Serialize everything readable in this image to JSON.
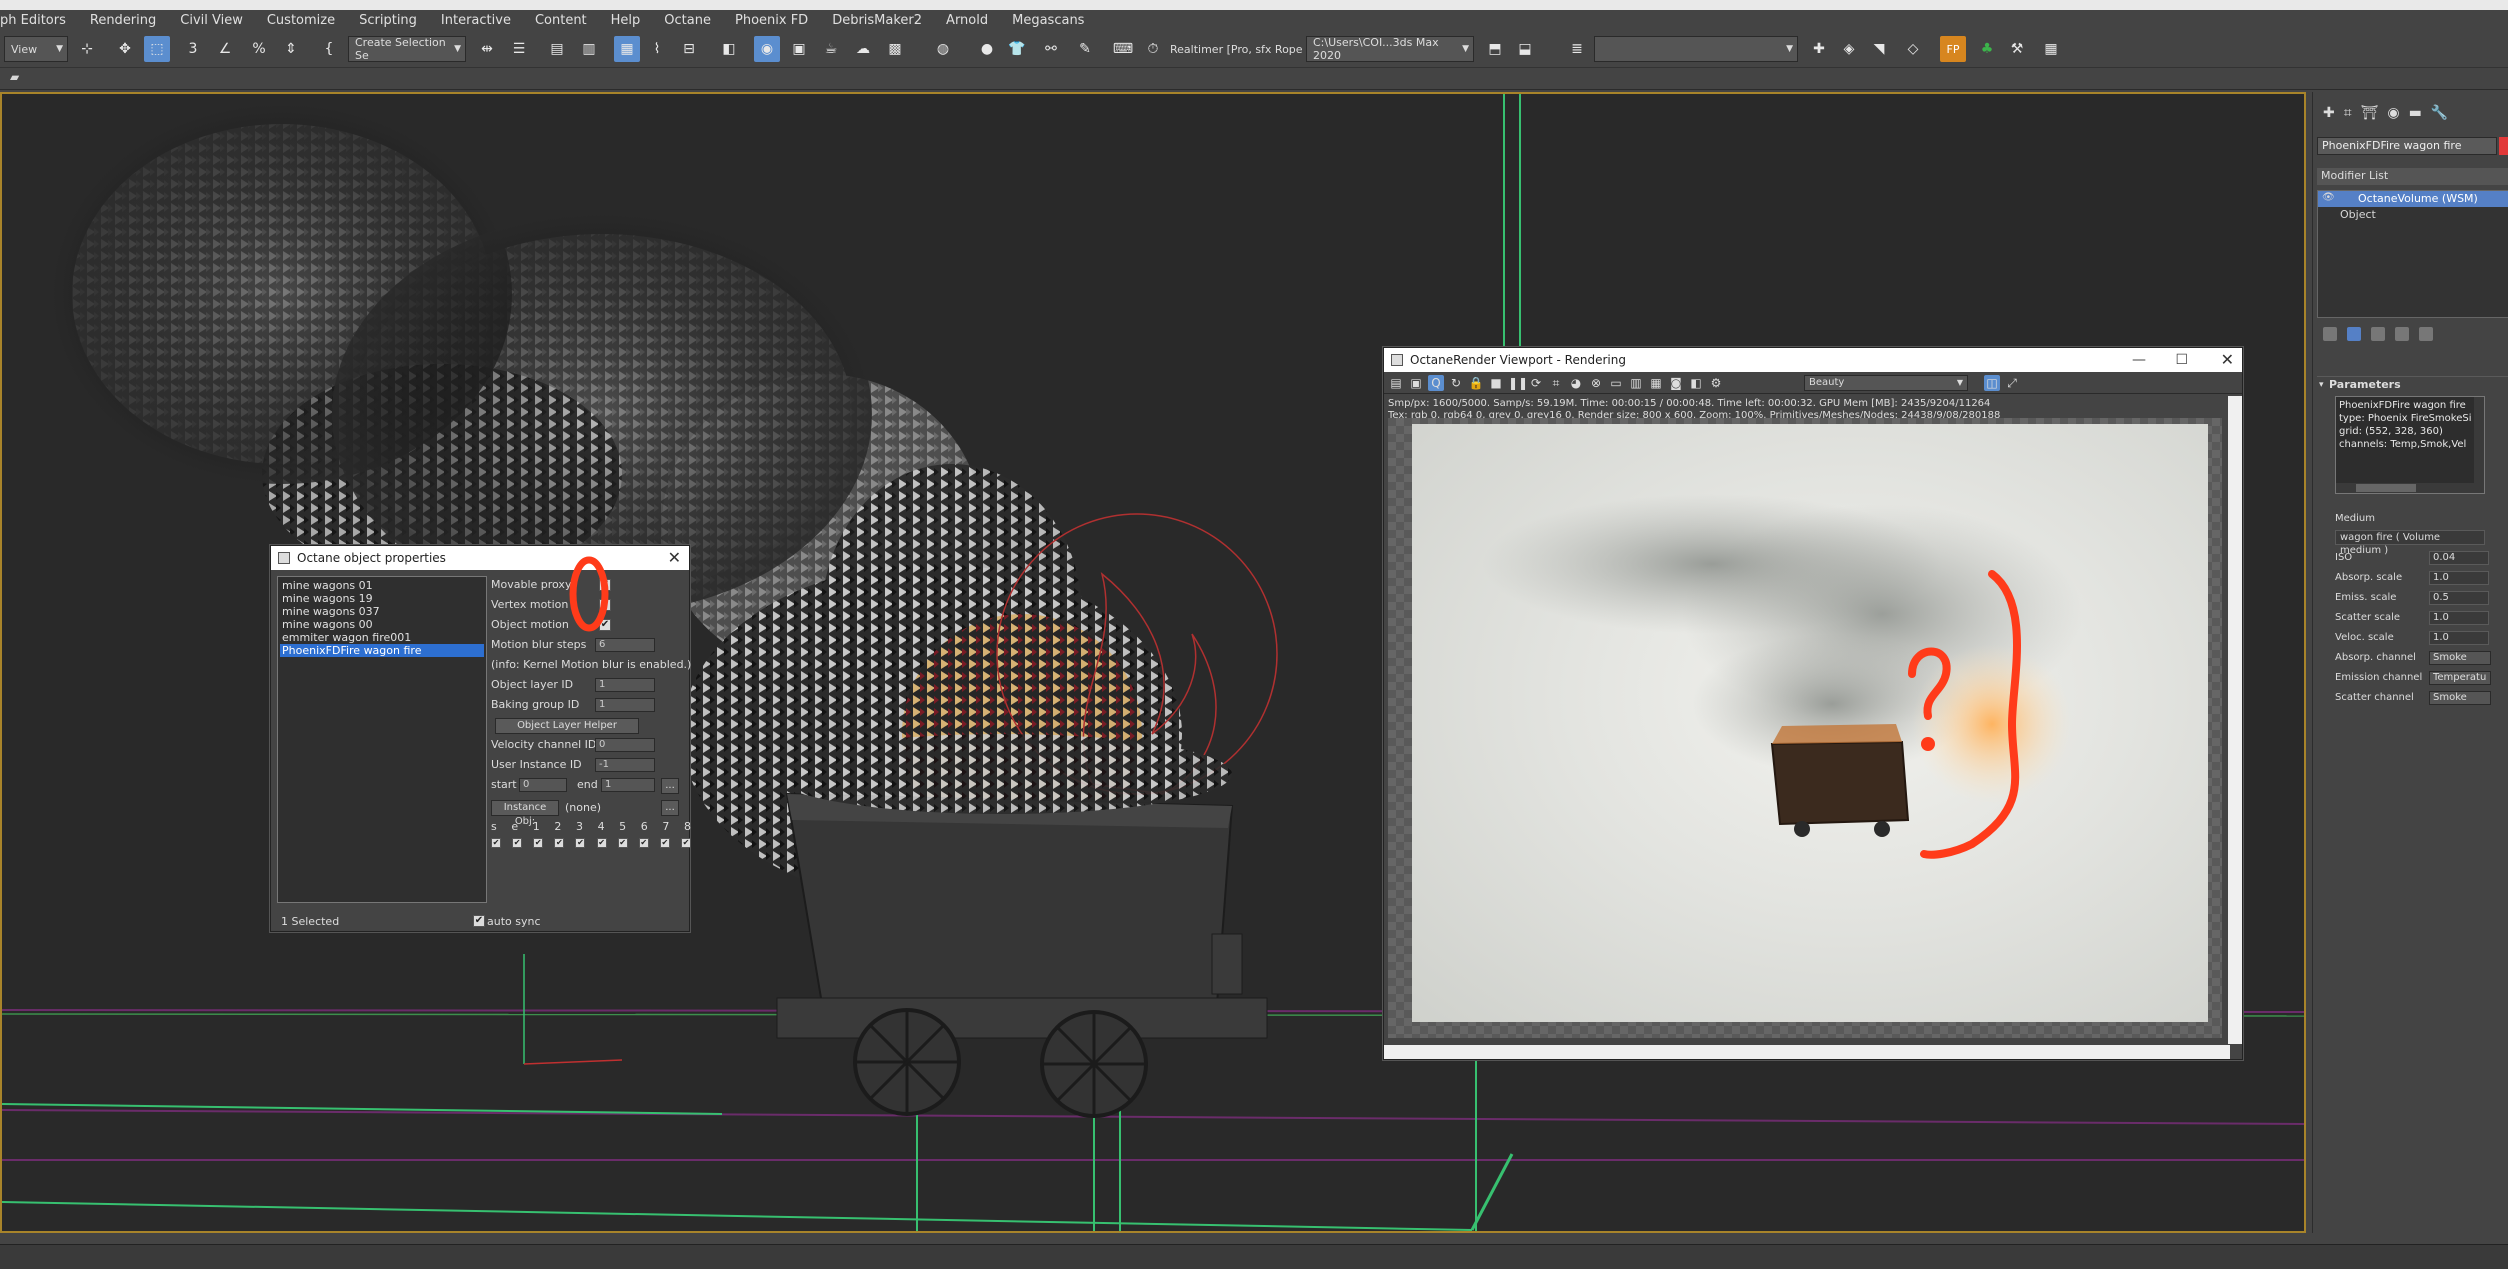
{
  "menu": [
    "ph Editors",
    "Rendering",
    "Civil View",
    "Customize",
    "Scripting",
    "Interactive",
    "Content",
    "Help",
    "Octane",
    "Phoenix FD",
    "DebrisMaker2",
    "Arnold",
    "Megascans"
  ],
  "toolbar": {
    "view_dropdown": "View",
    "selection_set": "Create Selection Se",
    "project_label": "Realtimer [Pro, sfx Rope C",
    "path_dropdown": "C:\\Users\\COI...3ds Max 2020"
  },
  "command_panel": {
    "object_name": "PhoenixFDFire wagon fire",
    "object_color": "#e23a3a",
    "modifier_list": "Modifier List",
    "stack": [
      "OctaneVolume (WSM)",
      "Object"
    ],
    "parameters_title": "Parameters",
    "info_lines": [
      "PhoenixFDFire wagon fire",
      "type: Phoenix FireSmokeSi",
      "grid: (552, 328, 360)",
      "channels: Temp,Smok,Vel"
    ],
    "medium_label": "Medium",
    "medium_value": "wagon fire  ( Volume medium )",
    "params": [
      {
        "label": "ISO",
        "value": "0.04"
      },
      {
        "label": "Absorp. scale",
        "value": "1.0"
      },
      {
        "label": "Emiss. scale",
        "value": "0.5"
      },
      {
        "label": "Scatter scale",
        "value": "1.0"
      },
      {
        "label": "Veloc. scale",
        "value": "1.0"
      }
    ],
    "channels": [
      {
        "label": "Absorp. channel",
        "value": "Smoke"
      },
      {
        "label": "Emission channel",
        "value": "Temperatu"
      },
      {
        "label": "Scatter channel",
        "value": "Smoke"
      }
    ]
  },
  "object_props": {
    "title": "Octane object properties",
    "objects": [
      "mine wagons 01",
      "mine wagons 19",
      "mine wagons 037",
      "mine wagons 00",
      "emmiter wagon fire001",
      "PhoenixFDFire wagon fire"
    ],
    "selected_index": 5,
    "movable_proxy": "Movable proxy",
    "vertex_motion": "Vertex motion",
    "object_motion": "Object motion",
    "motion_blur_steps": "Motion blur steps",
    "motion_blur_steps_value": "6",
    "info": "(info: Kernel Motion blur is enabled.)",
    "object_layer_id": "Object layer ID",
    "object_layer_id_value": "1",
    "baking_group_id": "Baking group ID",
    "baking_group_id_value": "1",
    "layer_helper_button": "Object Layer Helper",
    "velocity_channel_id": "Velocity channel ID",
    "velocity_channel_id_value": "0",
    "user_instance_id": "User Instance ID",
    "user_instance_id_value": "-1",
    "start_label": "start",
    "start_value": "0",
    "end_label": "end",
    "end_value": "1",
    "ellipsis": "...",
    "instance_obj_button": "Instance Obj:",
    "instance_obj_value": "(none)",
    "letters": [
      "s",
      "e",
      "1",
      "2",
      "3",
      "4",
      "5",
      "6",
      "7",
      "8"
    ],
    "selected_count": "1 Selected",
    "auto_sync": "auto sync"
  },
  "render_viewport": {
    "title": "OctaneRender Viewport - Rendering",
    "pass": "Beauty",
    "stats_line1": "Smp/px: 1600/5000.   Samp/s: 59.19M.   Time: 00:00:15 / 00:00:48.   Time left: 00:00:32.   GPU Mem [MB]: 2435/9204/11264",
    "stats_line2": "Tex: rgb 0, rgb64 0, grey 0, grey16 0.   Render size: 800 x 600.   Zoom: 100%.   Primitives/Meshes/Nodes: 24438/9/08/280188"
  }
}
